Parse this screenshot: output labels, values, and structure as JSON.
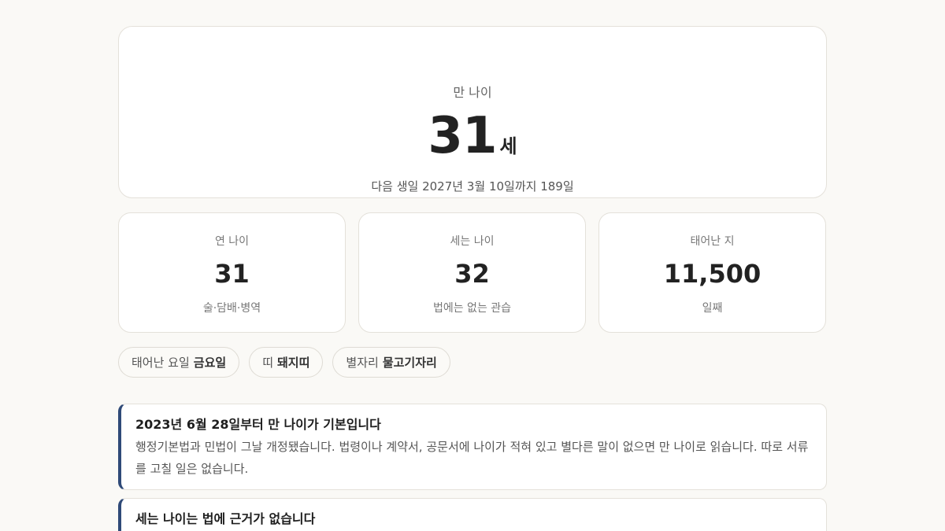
{
  "hero": {
    "label": "만 나이",
    "value": "31",
    "unit": "세",
    "sub": "다음 생일 2027년 3월 10일까지 189일"
  },
  "stats": [
    {
      "label": "연 나이",
      "value": "31",
      "note": "술·담배·병역"
    },
    {
      "label": "세는 나이",
      "value": "32",
      "note": "법에는 없는 관습"
    },
    {
      "label": "태어난 지",
      "value": "11,500",
      "note": "일째"
    }
  ],
  "chips": [
    {
      "label": "태어난 요일",
      "value": "금요일"
    },
    {
      "label": "띠",
      "value": "돼지띠"
    },
    {
      "label": "별자리",
      "value": "물고기자리"
    }
  ],
  "notices": [
    {
      "title": "2023년 6월 28일부터 만 나이가 기본입니다",
      "body": "행정기본법과 민법이 그날 개정됐습니다. 법령이나 계약서, 공문서에 나이가 적혀 있고 별다른 말이 없으면 만 나이로 읽습니다. 따로 서류를 고칠 일은 없습니다."
    },
    {
      "title": "세는 나이는 법에 근거가 없습니다",
      "body": ""
    }
  ],
  "colors": {
    "background": "#faf9f6",
    "card": "#ffffff",
    "accent": "#2f4a78"
  }
}
